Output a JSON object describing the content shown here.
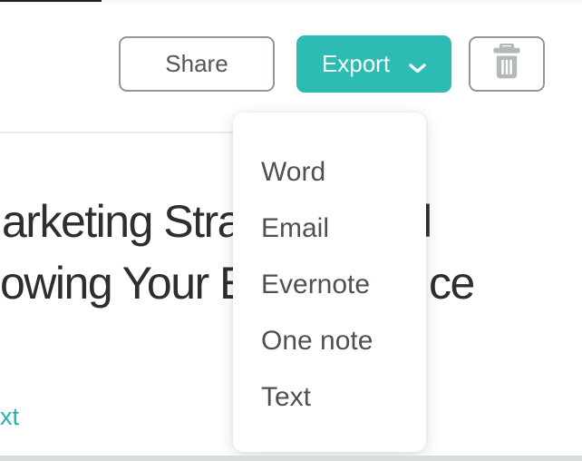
{
  "toolbar": {
    "share_label": "Share",
    "export_label": "Export",
    "chevron_icon": "chevron-down",
    "trash_icon": "trash"
  },
  "dropdown": {
    "items": [
      "Word",
      "Email",
      "Evernote",
      "One note",
      "Text"
    ]
  },
  "document": {
    "heading_line1_left": "arketing Stra",
    "heading_line1_right": "l",
    "heading_line2_left": "owing Your E",
    "heading_line2_right": "ce",
    "link_fragment": "xt"
  },
  "colors": {
    "accent_teal": "#2dbcb3",
    "link_teal": "#26b3aa",
    "button_border_gray": "#929697",
    "trash_icon_gray": "#b5b8b9",
    "menu_text": "#4d5154",
    "heading_text": "#2c2e2f",
    "divider": "#e9eaea",
    "bottom_band": "#d8dcdb"
  }
}
